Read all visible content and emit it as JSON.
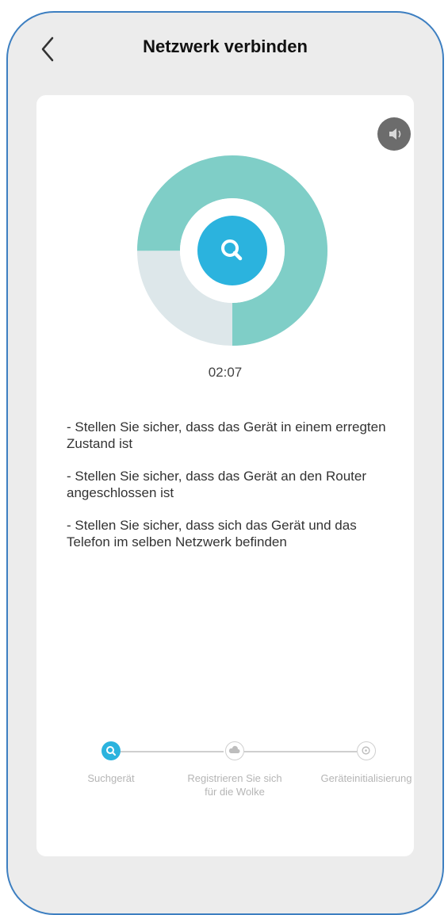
{
  "header": {
    "title": "Netzwerk verbinden"
  },
  "progress": {
    "timer": "02:07",
    "ring_fill_fraction": 0.75
  },
  "tips": [
    "- Stellen Sie sicher, dass das Gerät in einem erregten Zustand ist",
    "- Stellen Sie sicher, dass das Gerät an den Router angeschlossen ist",
    "- Stellen Sie sicher, dass sich das Gerät und das Telefon im selben Netzwerk befinden"
  ],
  "steps": [
    {
      "label": "Suchgerät",
      "icon": "search-icon",
      "active": true
    },
    {
      "label": "Registrieren Sie sich für die Wolke",
      "icon": "cloud-icon",
      "active": false
    },
    {
      "label": "Geräteinitialisierung",
      "icon": "init-icon",
      "active": false
    }
  ],
  "colors": {
    "accent": "#2bb3de",
    "ring_fill": "#7fcec7",
    "ring_track": "#dde7ea",
    "frame_border": "#3d7fc1"
  }
}
